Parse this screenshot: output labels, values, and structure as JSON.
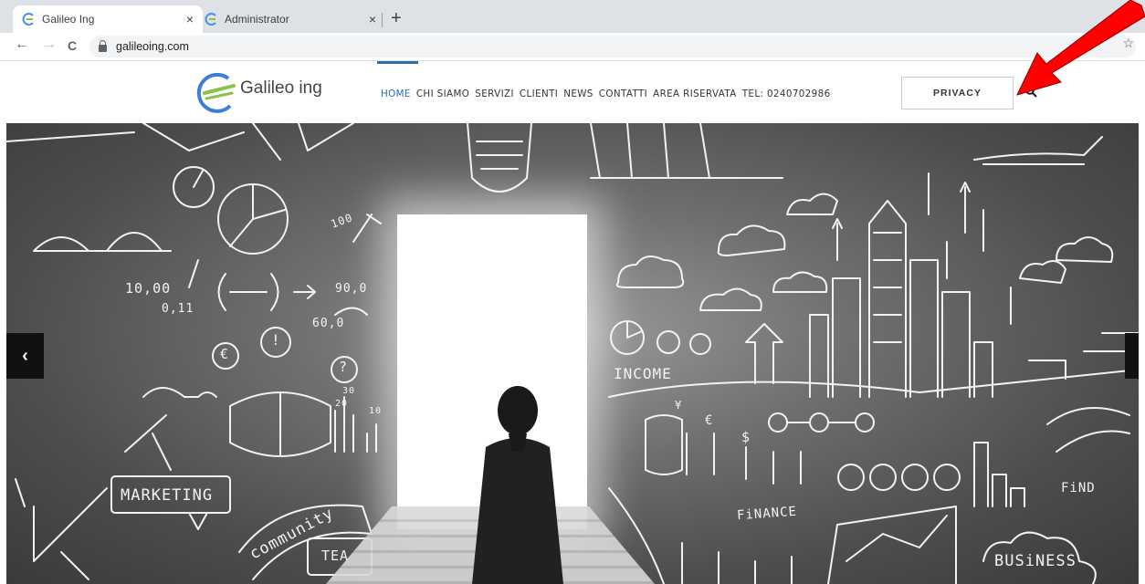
{
  "browser": {
    "tabs": [
      {
        "title": "Galileo Ing",
        "active": true
      },
      {
        "title": "Administrator",
        "active": false
      }
    ],
    "close_glyph": "×",
    "new_tab_glyph": "+",
    "back_glyph": "←",
    "forward_glyph": "→",
    "reload_glyph": "C",
    "url": "galileoing.com",
    "star_glyph": "☆"
  },
  "site": {
    "logo_text": "Galileo ing",
    "nav": [
      {
        "label": "HOME",
        "active": true
      },
      {
        "label": "CHI SIAMO",
        "active": false
      },
      {
        "label": "SERVIZI",
        "active": false
      },
      {
        "label": "CLIENTI",
        "active": false
      },
      {
        "label": "NEWS",
        "active": false
      },
      {
        "label": "CONTATTI",
        "active": false
      },
      {
        "label": "AREA RISERVATA",
        "active": false
      },
      {
        "label": "TEL: 0240702986",
        "active": false
      }
    ],
    "privacy_label": "PRIVACY",
    "accent_color": "#2b6cb0"
  },
  "hero": {
    "chalk_labels": {
      "marketing": "MARKETING",
      "community": "community",
      "team": "TEA",
      "income": "INCOME",
      "finance": "FiNANCE",
      "find": "FiND",
      "business": "BUSiNESS",
      "fraction_a": "10,00",
      "fraction_b": "0,11",
      "val_100": "100",
      "val_90": "90,0",
      "val_60": "60,0",
      "euro": "€",
      "dollar": "$",
      "yen": "¥",
      "question": "?",
      "exclaim": "!",
      "val_30": "30",
      "val_20": "20",
      "val_10": "10"
    },
    "prev_glyph": "‹"
  },
  "annotation": {
    "arrow_color": "#ff0000"
  }
}
